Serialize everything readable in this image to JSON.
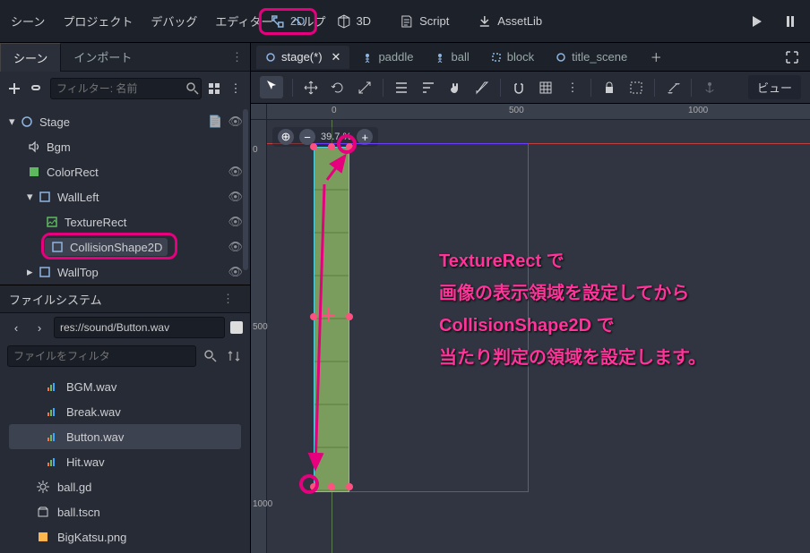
{
  "menus": [
    "シーン",
    "プロジェクト",
    "デバッグ",
    "エディター",
    "ヘルプ"
  ],
  "modes": {
    "m2d": "2D",
    "m3d": "3D",
    "script": "Script",
    "assetlib": "AssetLib"
  },
  "dock": {
    "scene": "シーン",
    "import": "インポート"
  },
  "scene_toolbar": {
    "filter_ph": "フィルター: 名前"
  },
  "tree": {
    "stage": "Stage",
    "bgm": "Bgm",
    "colorrect": "ColorRect",
    "wallleft": "WallLeft",
    "texturerect": "TextureRect",
    "collision": "CollisionShape2D",
    "walltop": "WallTop"
  },
  "fs": {
    "title": "ファイルシステム",
    "path": "res://sound/Button.wav",
    "filter_ph": "ファイルをフィルタ",
    "items": {
      "bgm": "BGM.wav",
      "break": "Break.wav",
      "button": "Button.wav",
      "hit": "Hit.wav",
      "ballgd": "ball.gd",
      "balltscn": "ball.tscn",
      "bigkatsu": "BigKatsu.png"
    }
  },
  "ed_tabs": {
    "stage": "stage(*)",
    "paddle": "paddle",
    "ball": "ball",
    "block": "block",
    "title": "title_scene"
  },
  "vp": {
    "view": "ビュー"
  },
  "zoom": {
    "pct": "39.7 %"
  },
  "ruler_h": {
    "t0": "0",
    "t500": "500",
    "t1000": "1000"
  },
  "ruler_v": {
    "t0": "0",
    "t500": "500",
    "t1000": "1000"
  },
  "annotation": {
    "l1": "TextureRect で",
    "l2": "画像の表示領域を設定してから",
    "l3": "CollisionShape2D で",
    "l4": "当たり判定の領域を設定します。"
  }
}
